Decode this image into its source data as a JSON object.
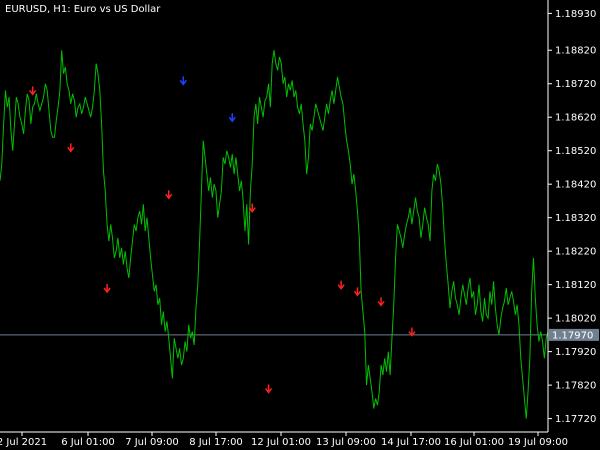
{
  "header": {
    "title": "EURUSD, H1:  Euro vs US Dollar"
  },
  "colors": {
    "background": "#000000",
    "price_line": "#00c000",
    "axis": "#ffffff",
    "current_price_line": "#708090",
    "current_price_label_bg": "#708090",
    "sell_arrow": "#ff2020",
    "buy_arrow": "#2040ff"
  },
  "chart_data": {
    "type": "line",
    "symbol": "EURUSD",
    "timeframe": "H1",
    "ylim": [
      1.1768,
      1.1897
    ],
    "y_ticks": [
      1.1893,
      1.1882,
      1.1872,
      1.1862,
      1.1852,
      1.1842,
      1.1832,
      1.1822,
      1.1812,
      1.1802,
      1.1792,
      1.1782,
      1.1772
    ],
    "x_tick_labels": [
      "2 Jul 2021",
      "6 Jul 01:00",
      "7 Jul 09:00",
      "8 Jul 17:00",
      "12 Jul 01:00",
      "13 Jul 09:00",
      "14 Jul 17:00",
      "16 Jul 01:00",
      "19 Jul 09:00"
    ],
    "current_price": 1.1797,
    "current_price_label": "1.17970",
    "series": [
      {
        "values": [
          1.1843,
          1.1848,
          1.186,
          1.187,
          1.1865,
          1.1868,
          1.1858,
          1.1852,
          1.186,
          1.1868,
          1.1866,
          1.1862,
          1.186,
          1.1857,
          1.1864,
          1.1869,
          1.1867,
          1.186,
          1.1865,
          1.1866,
          1.1869,
          1.1866,
          1.1864,
          1.1866,
          1.1868,
          1.1872,
          1.187,
          1.1864,
          1.1858,
          1.1856,
          1.1856,
          1.1861,
          1.1865,
          1.187,
          1.1882,
          1.1875,
          1.1877,
          1.1872,
          1.187,
          1.1866,
          1.1869,
          1.1867,
          1.1862,
          1.1865,
          1.1866,
          1.1863,
          1.1865,
          1.1868,
          1.1866,
          1.1864,
          1.1862,
          1.1865,
          1.187,
          1.1878,
          1.1875,
          1.187,
          1.186,
          1.1846,
          1.184,
          1.183,
          1.1825,
          1.183,
          1.1826,
          1.182,
          1.1822,
          1.1826,
          1.182,
          1.1823,
          1.1818,
          1.1822,
          1.1817,
          1.1814,
          1.182,
          1.1825,
          1.183,
          1.1828,
          1.1832,
          1.1834,
          1.183,
          1.1836,
          1.1828,
          1.1832,
          1.1826,
          1.182,
          1.1815,
          1.181,
          1.1812,
          1.1806,
          1.1808,
          1.18,
          1.1804,
          1.1798,
          1.1801,
          1.1796,
          1.179,
          1.1784,
          1.1796,
          1.1793,
          1.179,
          1.1793,
          1.1788,
          1.179,
          1.1795,
          1.1792,
          1.18,
          1.1796,
          1.1798,
          1.1794,
          1.1805,
          1.1812,
          1.1825,
          1.184,
          1.1855,
          1.185,
          1.1845,
          1.184,
          1.1844,
          1.1838,
          1.1842,
          1.184,
          1.1832,
          1.1836,
          1.184,
          1.185,
          1.1848,
          1.1852,
          1.185,
          1.1847,
          1.1851,
          1.1845,
          1.185,
          1.1845,
          1.184,
          1.1843,
          1.1837,
          1.1828,
          1.1836,
          1.1824,
          1.184,
          1.1848,
          1.1862,
          1.1866,
          1.186,
          1.1868,
          1.1865,
          1.1862,
          1.1867,
          1.1868,
          1.1872,
          1.1865,
          1.1878,
          1.1882,
          1.1878,
          1.1876,
          1.188,
          1.1878,
          1.1872,
          1.1874,
          1.1868,
          1.1872,
          1.187,
          1.1873,
          1.1868,
          1.187,
          1.1865,
          1.1863,
          1.1866,
          1.186,
          1.1855,
          1.1845,
          1.185,
          1.186,
          1.1858,
          1.1862,
          1.1866,
          1.1864,
          1.1862,
          1.186,
          1.1858,
          1.1862,
          1.1866,
          1.1863,
          1.1867,
          1.187,
          1.1866,
          1.187,
          1.1874,
          1.1871,
          1.1868,
          1.1866,
          1.186,
          1.1855,
          1.1852,
          1.1848,
          1.1842,
          1.1845,
          1.184,
          1.1834,
          1.1826,
          1.181,
          1.1804,
          1.1798,
          1.1782,
          1.1788,
          1.1784,
          1.178,
          1.1775,
          1.1778,
          1.1776,
          1.178,
          1.1788,
          1.1785,
          1.179,
          1.1786,
          1.1792,
          1.1785,
          1.1796,
          1.1806,
          1.182,
          1.183,
          1.1828,
          1.1826,
          1.1823,
          1.1827,
          1.183,
          1.1832,
          1.1835,
          1.183,
          1.1834,
          1.1838,
          1.1834,
          1.1832,
          1.1826,
          1.183,
          1.1835,
          1.1832,
          1.183,
          1.1825,
          1.184,
          1.1845,
          1.1843,
          1.1848,
          1.1846,
          1.1842,
          1.1835,
          1.1825,
          1.1818,
          1.1812,
          1.1805,
          1.181,
          1.1813,
          1.1808,
          1.1806,
          1.1803,
          1.1808,
          1.1812,
          1.1809,
          1.1806,
          1.1811,
          1.1814,
          1.1808,
          1.181,
          1.1803,
          1.1806,
          1.1812,
          1.1804,
          1.1801,
          1.1808,
          1.1803,
          1.1802,
          1.181,
          1.1806,
          1.1813,
          1.1805,
          1.18,
          1.1797,
          1.1802,
          1.1805,
          1.1807,
          1.1811,
          1.1806,
          1.1808,
          1.181,
          1.1807,
          1.1803,
          1.1806,
          1.18,
          1.179,
          1.1784,
          1.1778,
          1.1772,
          1.178,
          1.179,
          1.181,
          1.182,
          1.1808,
          1.18,
          1.1795,
          1.1798,
          1.1795,
          1.179,
          1.1796,
          1.1798
        ],
        "annotations": [
          {
            "type": "sell",
            "index": 18,
            "value": 1.187
          },
          {
            "type": "sell",
            "index": 39,
            "value": 1.1853
          },
          {
            "type": "sell",
            "index": 59,
            "value": 1.1811
          },
          {
            "type": "sell",
            "index": 93,
            "value": 1.1839
          },
          {
            "type": "buy",
            "index": 101,
            "value": 1.1873
          },
          {
            "type": "buy",
            "index": 128,
            "value": 1.1862
          },
          {
            "type": "sell",
            "index": 139,
            "value": 1.1835
          },
          {
            "type": "sell",
            "index": 148,
            "value": 1.1781
          },
          {
            "type": "sell",
            "index": 188,
            "value": 1.1812
          },
          {
            "type": "sell",
            "index": 197,
            "value": 1.181
          },
          {
            "type": "sell",
            "index": 210,
            "value": 1.1807
          },
          {
            "type": "sell",
            "index": 227,
            "value": 1.1798
          }
        ]
      }
    ]
  }
}
